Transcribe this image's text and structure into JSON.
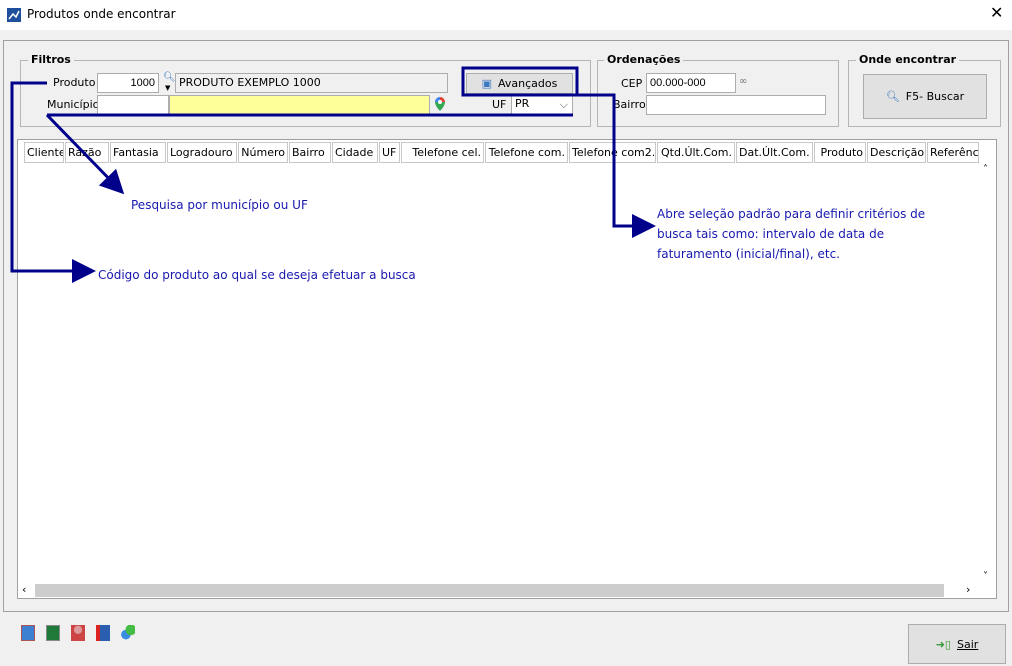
{
  "window": {
    "title": "Produtos onde encontrar",
    "close": "✕"
  },
  "filtros": {
    "title": "Filtros",
    "produto_label": "Produto",
    "produto_code": "1000",
    "produto_desc": "PRODUTO EXEMPLO 1000",
    "municipio_label": "Município",
    "municipio_code": "",
    "municipio_name": "",
    "uf_label": "UF",
    "uf_value": "PR",
    "advanced_label": "Avançados"
  },
  "ordenacoes": {
    "title": "Ordenações",
    "cep_label": "CEP",
    "cep_value": "00.000-000",
    "bairro_label": "Bairro",
    "bairro_value": ""
  },
  "onde": {
    "title": "Onde encontrar",
    "search_label": "F5- Buscar"
  },
  "table": {
    "columns": [
      "Cliente",
      "Razão",
      "Fantasia",
      "Logradouro",
      "Número",
      "Bairro",
      "Cidade",
      "UF",
      "Telefone cel.",
      "Telefone com.",
      "Telefone com2.",
      "Qtd.Últ.Com.",
      "Dat.Últ.Com.",
      "Produto",
      "Descrição",
      "Referênci"
    ],
    "rows": []
  },
  "annotations": {
    "municipio": "Pesquisa por município ou UF",
    "produto": "Código do produto ao qual se deseja efetuar a busca",
    "avancados": [
      "Abre seleção padrão para definir critérios de",
      "busca tais como: intervalo de data de",
      "faturamento (inicial/final), etc."
    ]
  },
  "footer": {
    "exit_label": "Sair",
    "tool_icons": [
      "report-icon",
      "excel-icon",
      "user-icon",
      "export-icon",
      "chart-icon"
    ]
  },
  "colors": {
    "annotation": "#00008b",
    "highlight": "#ffff99"
  }
}
